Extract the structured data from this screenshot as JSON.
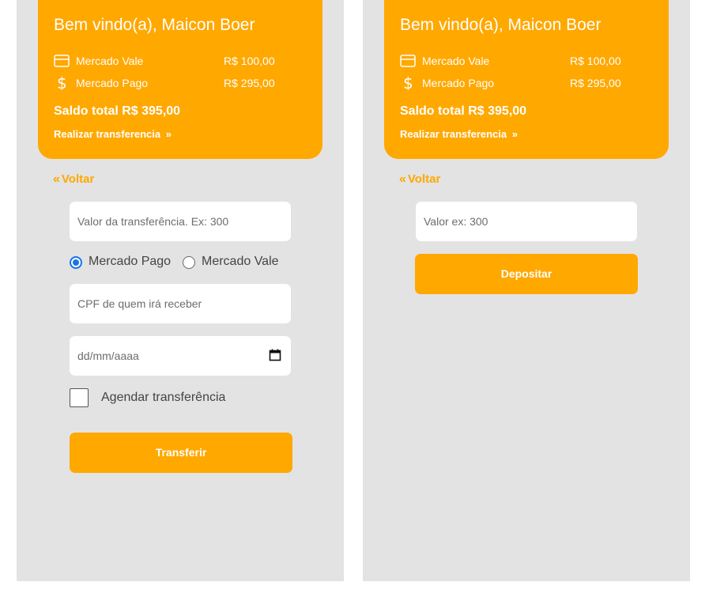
{
  "colors": {
    "accent": "#ffa800",
    "panel_bg": "#e3e3e3",
    "radio_selected": "#1a73e8"
  },
  "header": {
    "welcome": "Bem vindo(a), Maicon Boer",
    "accounts": [
      {
        "icon": "credit-card-icon",
        "name": "Mercado Vale",
        "value": "R$ 100,00"
      },
      {
        "icon": "dollar-icon",
        "name": "Mercado Pago",
        "value": "R$ 295,00"
      }
    ],
    "total": "Saldo total R$ 395,00",
    "transfer_link": "Realizar transferencia",
    "transfer_link_chevron": "»"
  },
  "back": {
    "chevron": "«",
    "label": "Voltar"
  },
  "transfer_form": {
    "amount_placeholder": "Valor da transferência. Ex: 300",
    "radio_options": [
      {
        "label": "Mercado Pago",
        "checked": true
      },
      {
        "label": "Mercado Vale",
        "checked": false
      }
    ],
    "cpf_placeholder": "CPF de quem irá receber",
    "date_placeholder": "dd/mm/aaaa",
    "schedule_label": "Agendar transferência",
    "submit_label": "Transferir"
  },
  "deposit_form": {
    "amount_placeholder": "Valor ex: 300",
    "submit_label": "Depositar"
  }
}
